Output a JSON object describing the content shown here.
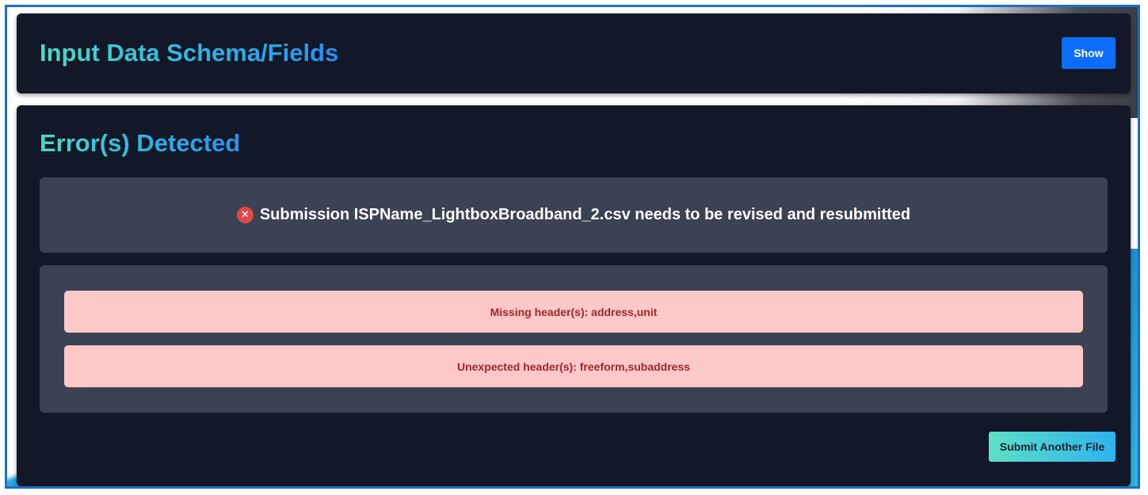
{
  "schema_card": {
    "title": "Input Data Schema/Fields",
    "show_label": "Show"
  },
  "errors_card": {
    "title": "Error(s) Detected",
    "summary": {
      "icon": "error-x-circle-icon",
      "text": "Submission ISPName_LightboxBroadband_2.csv needs to be revised and resubmitted"
    },
    "messages": [
      "Missing header(s): address,unit",
      "Unexpected header(s): freeform,subaddress"
    ],
    "submit_label": "Submit Another File"
  },
  "colors": {
    "card_bg": "#121827",
    "panel_bg": "#3b4252",
    "error_row_bg": "#fdc8c8",
    "error_text": "#a0262a",
    "error_icon": "#e04848",
    "primary_button": "#0d6efd",
    "accent_gradient_start": "#4fd8c2",
    "accent_gradient_end": "#2a90f0"
  }
}
